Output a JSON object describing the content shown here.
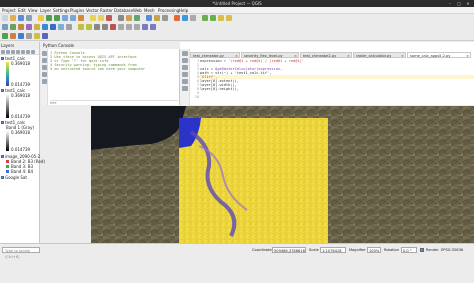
{
  "window": {
    "title": "*Untitled Project — QGIS",
    "controls": [
      "–",
      "□",
      "✕"
    ]
  },
  "menu": [
    "Project",
    "Edit",
    "View",
    "Layer",
    "Settings",
    "Plugins",
    "Vector",
    "Raster",
    "Database",
    "Web",
    "Mesh",
    "Processing",
    "Help"
  ],
  "layers_panel": {
    "header": "Layers",
    "items": [
      {
        "label": "test1_calc",
        "checked": true
      },
      {
        "label": "test1_calc",
        "checked": true
      },
      {
        "label": "test1_calc",
        "checked": true
      },
      {
        "label": "image_2090-05-24_1708",
        "checked": true
      },
      {
        "label": "Google Sat",
        "checked": true
      }
    ],
    "legends": [
      {
        "max": "0.369018",
        "min": "0.014739"
      },
      {
        "max": "0.369018",
        "min": "0.014739"
      },
      {
        "label": "Band 1 (Gray)",
        "max": "0.369018",
        "min": "0.014739"
      }
    ],
    "bands": [
      {
        "label": "Band 1 (Gray)",
        "color": "#d94040"
      },
      {
        "label": "Band 2: B3 (Red)",
        "color": "#d94040"
      },
      {
        "label": "Band 3: B3",
        "color": "#3fae3f"
      },
      {
        "label": "Band 4: B4",
        "color": "#3b6fd9"
      }
    ]
  },
  "console": {
    "header": "Python Console",
    "lines": [
      "1 Python Console",
      "2 Use iface to access QGIS API interface",
      "3 or Type '?' for more info",
      "4 Security warning: typing commands from",
      "5 an untrusted source can harm your computer"
    ],
    "prompt": ">>>"
  },
  "editor": {
    "tabs": [
      {
        "label": "test_chmeabe.py",
        "active": false
      },
      {
        "label": "severity_flex_level.py",
        "active": false
      },
      {
        "label": "test_chmeabe2.py",
        "active": false
      },
      {
        "label": "raster_calculator.py",
        "active": false
      },
      {
        "label": "some_calc_apps5.2.py",
        "active": true
      }
    ],
    "line_numbers": [
      "1",
      "2",
      "3",
      "4",
      "5",
      "6",
      "7",
      "8",
      "9",
      "10"
    ],
    "code": [
      {
        "prefix": "expression = ",
        "string": "'(red@1 + red@1) / (red@1 + red@1)'",
        "suffix": ""
      },
      {
        "prefix": "",
        "string": "",
        "suffix": ""
      },
      {
        "prefix": "calc = ",
        "string": "",
        "suffix": "QgsRasterCalculator(expression,"
      },
      {
        "prefix": "            ",
        "string": "",
        "suffix": "path = str(~) + 'test1_calc.tif',"
      },
      {
        "prefix": "            ",
        "string": "'GTiff',",
        "suffix": ""
      },
      {
        "prefix": "            ",
        "string": "",
        "suffix": "layer[0].extent(),"
      },
      {
        "prefix": "            ",
        "string": "",
        "suffix": "layer[0].width(),"
      },
      {
        "prefix": "            ",
        "string": "",
        "suffix": "layer[0].height(),"
      }
    ]
  },
  "status": {
    "search_placeholder": "Type to locate (Ctrl+K)",
    "coordinate_label": "Coordinate",
    "coordinate_value": "509486,3786616",
    "scale_label": "Scale",
    "scale_value": "1:1076418",
    "magnifier_label": "Magnifier",
    "magnifier_value": "100%",
    "rotation_label": "Rotation",
    "rotation_value": "0.0 °",
    "render_label": "Render",
    "crs_value": "EPSG:32636"
  },
  "colors": {
    "accent": "#5a8fd8",
    "raster_high": "#f2e43a",
    "raster_low": "#3b3bbf"
  }
}
